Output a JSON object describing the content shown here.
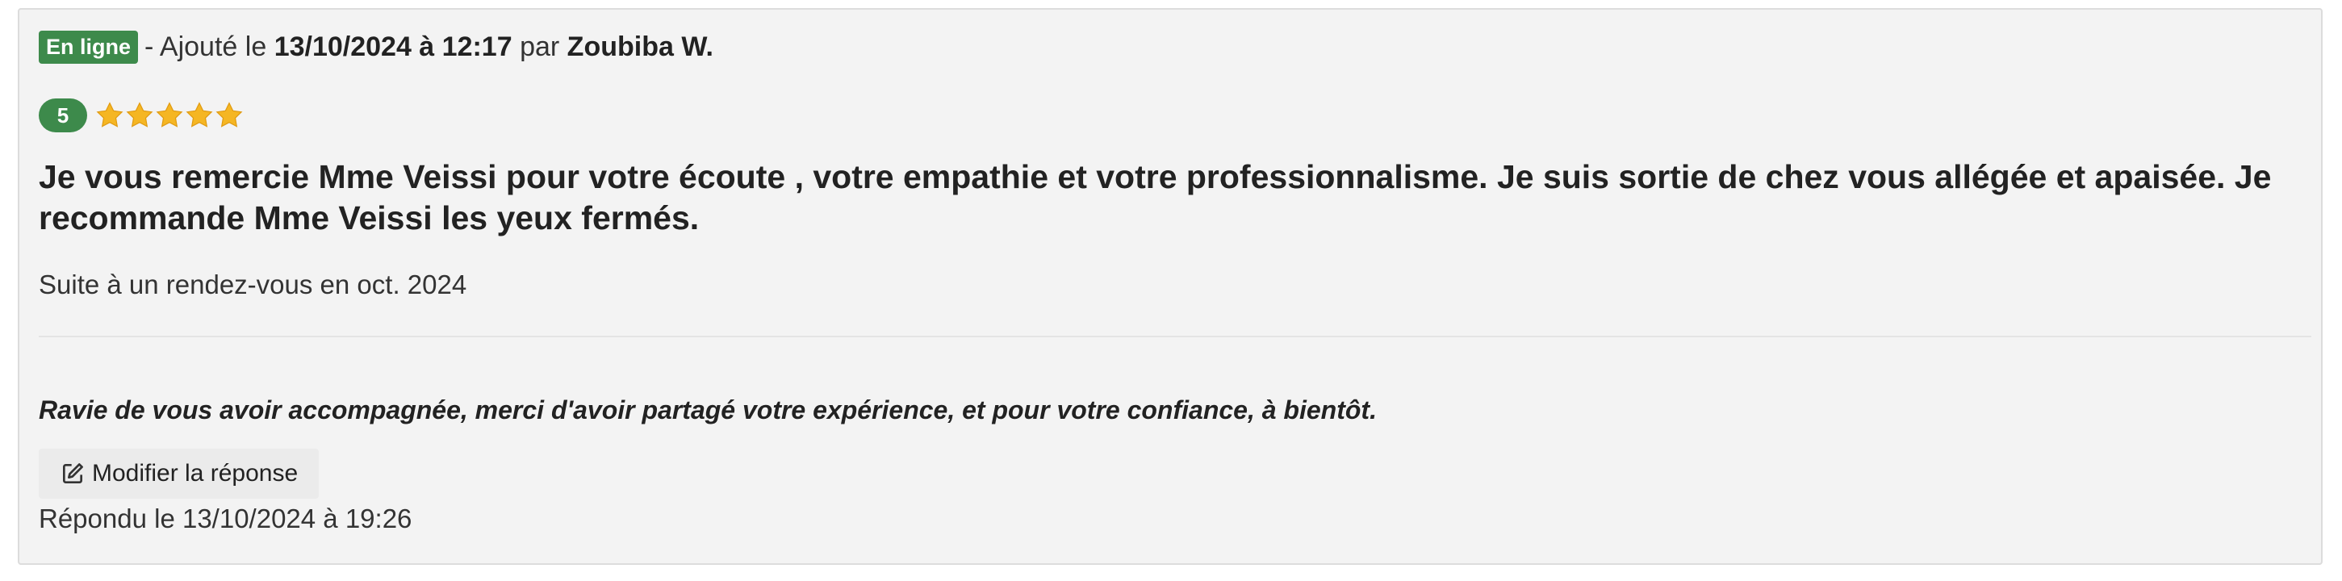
{
  "review": {
    "badge_label": "En ligne",
    "added_prefix": "- Ajouté le",
    "added_datetime": "13/10/2024 à 12:17",
    "by_label": "par",
    "author": "Zoubiba W.",
    "rating_value": "5",
    "stars_filled": 5,
    "stars_total": 5,
    "text": "Je vous remercie Mme Veissi pour votre écoute , votre empathie et votre professionnalisme. Je suis sortie de chez vous allégée et apaisée. Je recommande Mme Veissi les yeux fermés.",
    "appointment_note": "Suite à un rendez-vous en oct. 2024"
  },
  "response": {
    "text": "Ravie de vous avoir accompagnée, merci d'avoir partagé votre expérience, et pour votre confiance, à bientôt.",
    "edit_button_label": "Modifier la réponse",
    "edit_icon": "edit-icon",
    "replied_label": "Répondu le 13/10/2024 à 19:26"
  },
  "colors": {
    "accent_green": "#3d8a4b",
    "star_yellow": "#f5b623",
    "card_background": "#f3f3f3"
  }
}
